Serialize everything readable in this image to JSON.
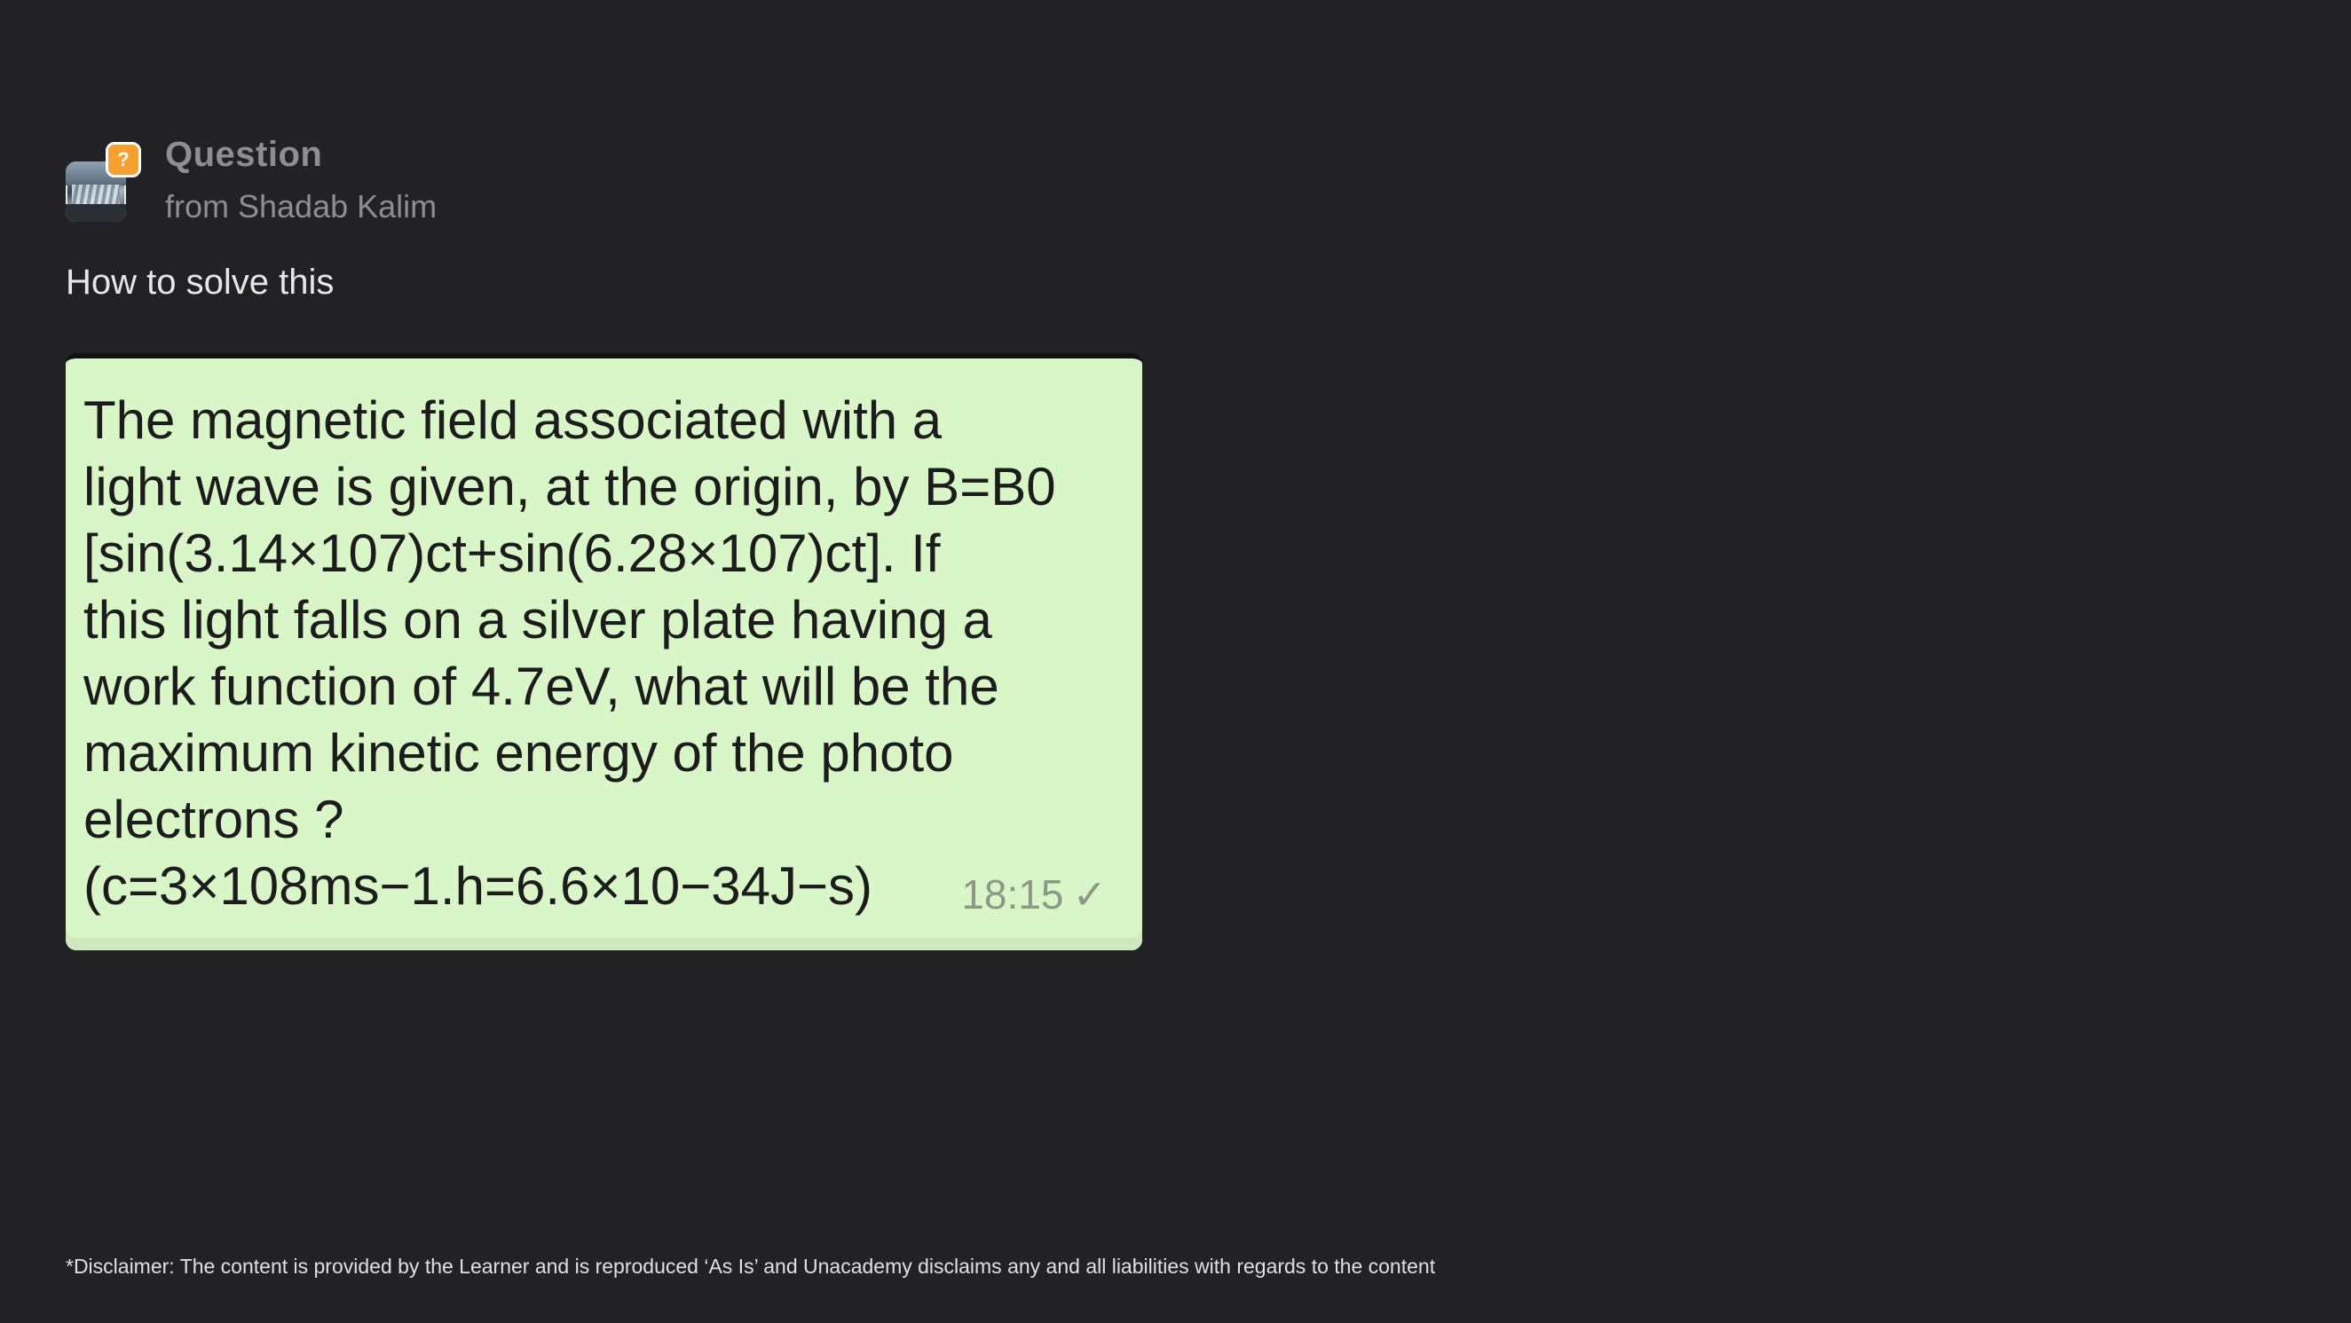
{
  "header": {
    "title": "Question",
    "from": "from Shadab Kalim",
    "badge_icon": "question-mark-icon",
    "badge_glyph": "?",
    "badge_color": "#f4a12f"
  },
  "question": {
    "text": "How to solve this",
    "image": {
      "lines": [
        "The magnetic field associated with a",
        "light wave is given, at the origin, by  B=B0",
        "[sin(3.14×107)ct+sin(6.28×107)ct]. If",
        "this light falls on a silver plate having a",
        "work function of 4.7eV, what will be the",
        "maximum kinetic energy of the photo",
        "electrons ?",
        "(c=3×108ms−1.h=6.6×10−34J−s)"
      ],
      "time": "18:15",
      "status_icon": "checkmark-icon",
      "status_glyph": "✓"
    }
  },
  "footer": {
    "disclaimer": "*Disclaimer: The content is provided by the Learner and is reproduced ‘As Is’ and Unacademy disclaims any and all liabilities with regards to the content"
  },
  "colors": {
    "background": "#222225",
    "image_background": "#d9f6c8"
  }
}
